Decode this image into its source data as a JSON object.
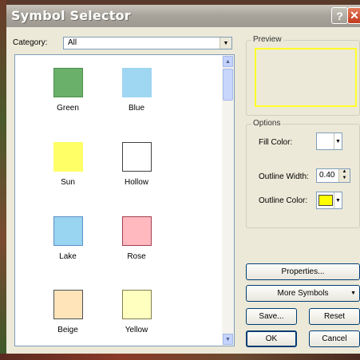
{
  "window": {
    "title": "Symbol Selector",
    "help_glyph": "?",
    "close_glyph": "✕"
  },
  "category": {
    "label": "Category:",
    "value": "All",
    "arrow": "▼"
  },
  "symbols": [
    {
      "name": "Green",
      "fill": "#6ab06a",
      "border": "#4d8f4d"
    },
    {
      "name": "Blue",
      "fill": "#9fd6f2",
      "border": "#9fd6f2"
    },
    {
      "name": "Sun",
      "fill": "#ffff66",
      "border": "#ffff66"
    },
    {
      "name": "Hollow",
      "fill": "#ffffff",
      "border": "#404040"
    },
    {
      "name": "Lake",
      "fill": "#99d4f0",
      "border": "#5b8fc7"
    },
    {
      "name": "Rose",
      "fill": "#ffb9bf",
      "border": "#a04050"
    },
    {
      "name": "Beige",
      "fill": "#ffe4b9",
      "border": "#505050"
    },
    {
      "name": "Yellow",
      "fill": "#ffffbf",
      "border": "#808050"
    }
  ],
  "preview": {
    "label": "Preview",
    "border_color": "#ffff28"
  },
  "options": {
    "label": "Options",
    "fill_color_label": "Fill Color:",
    "outline_width_label": "Outline Width:",
    "outline_width_value": "0.40",
    "outline_color_label": "Outline Color:",
    "outline_color": "#ffff00"
  },
  "buttons": {
    "properties": "Properties...",
    "more_symbols": "More Symbols",
    "save": "Save...",
    "reset": "Reset",
    "ok": "OK",
    "cancel": "Cancel"
  }
}
